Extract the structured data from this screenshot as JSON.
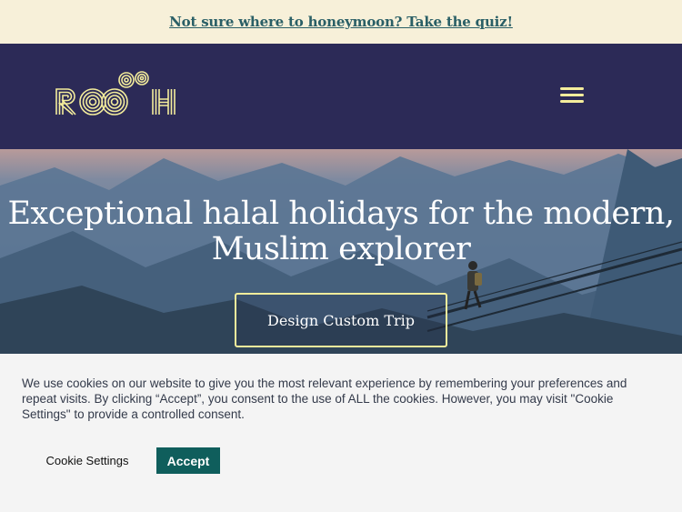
{
  "promo": {
    "link_text": "Not sure where to honeymoon? Take the quiz!"
  },
  "header": {
    "logo_text": "ROOH",
    "menu_icon": "hamburger-menu-icon"
  },
  "hero": {
    "title": "Exceptional halal holidays for the modern, Muslim explorer",
    "cta_label": "Design Custom Trip"
  },
  "cookie": {
    "message": "We use cookies on our website to give you the most relevant experience by remembering your preferences and repeat visits. By clicking “Accept”, you consent to the use of ALL the cookies. However, you may visit \"Cookie Settings\" to provide a controlled consent.",
    "settings_label": "Cookie Settings",
    "accept_label": "Accept"
  },
  "colors": {
    "promo_bg": "#f7f0d9",
    "promo_link": "#2a5f66",
    "header_bg": "#2c2a57",
    "accent_yellow": "#f4ed9c",
    "accept_bg": "#0f5e5c",
    "cookie_bg": "#f4f4f4"
  }
}
